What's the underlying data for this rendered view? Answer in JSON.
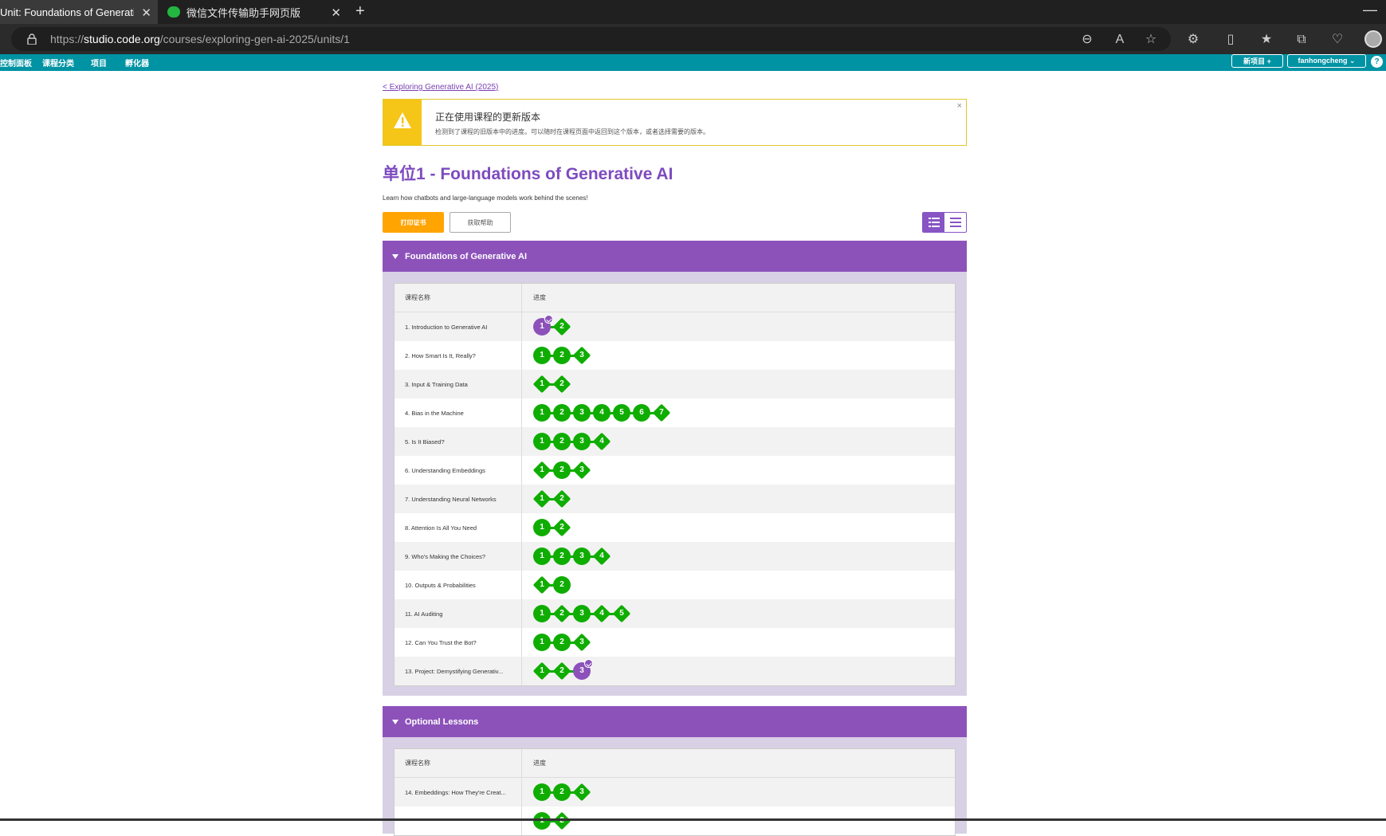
{
  "browser": {
    "tabs": [
      {
        "title": "Unit: Foundations of Generative",
        "active": true
      },
      {
        "title": "微信文件传输助手网页版",
        "active": false
      }
    ],
    "url_prefix": "https://",
    "url_domain": "studio.code.org",
    "url_path": "/courses/exploring-gen-ai-2025/units/1"
  },
  "site_nav": {
    "links": [
      "控制面板",
      "课程分类",
      "项目",
      "孵化器"
    ],
    "new_project": "新项目 +",
    "user": "fanhongcheng ⌄",
    "help": "?"
  },
  "back_link": "< Exploring Generative AI (2025)",
  "notice": {
    "title": "正在使用课程的更新版本",
    "body": "检测到了课程的旧版本中的进度。可以随时在课程页面中返回到这个版本，或者选择需要的版本。",
    "close": "×"
  },
  "unit": {
    "title": "单位1 - Foundations of Generative AI",
    "description": "Learn how chatbots and large-language models work behind the scenes!",
    "print_button": "打印证书",
    "help_button": "获取帮助"
  },
  "colors": {
    "progress_green": "#0fad00",
    "purple": "#8c52ba",
    "header_teal": "#0093a4",
    "orange": "#ffa400"
  },
  "sections": [
    {
      "title": "Foundations of Generative AI",
      "col_name": "课程名称",
      "col_progress": "进度",
      "lessons": [
        {
          "name": "1. Introduction to Generative AI",
          "levels": [
            {
              "n": "1",
              "shape": "circle",
              "color": "purple",
              "check": true
            },
            {
              "n": "2",
              "shape": "diamond"
            }
          ]
        },
        {
          "name": "2. How Smart Is It, Really?",
          "levels": [
            {
              "n": "1",
              "shape": "circle"
            },
            {
              "n": "2",
              "shape": "circle"
            },
            {
              "n": "3",
              "shape": "diamond"
            }
          ]
        },
        {
          "name": "3. Input & Training Data",
          "levels": [
            {
              "n": "1",
              "shape": "diamond"
            },
            {
              "n": "2",
              "shape": "diamond"
            }
          ]
        },
        {
          "name": "4. Bias in the Machine",
          "levels": [
            {
              "n": "1",
              "shape": "circle"
            },
            {
              "n": "2",
              "shape": "circle"
            },
            {
              "n": "3",
              "shape": "circle"
            },
            {
              "n": "4",
              "shape": "circle"
            },
            {
              "n": "5",
              "shape": "circle"
            },
            {
              "n": "6",
              "shape": "circle"
            },
            {
              "n": "7",
              "shape": "diamond"
            }
          ]
        },
        {
          "name": "5. Is It Biased?",
          "levels": [
            {
              "n": "1",
              "shape": "circle"
            },
            {
              "n": "2",
              "shape": "circle"
            },
            {
              "n": "3",
              "shape": "circle"
            },
            {
              "n": "4",
              "shape": "diamond"
            }
          ]
        },
        {
          "name": "6. Understanding Embeddings",
          "levels": [
            {
              "n": "1",
              "shape": "diamond"
            },
            {
              "n": "2",
              "shape": "circle"
            },
            {
              "n": "3",
              "shape": "diamond"
            }
          ]
        },
        {
          "name": "7. Understanding Neural Networks",
          "levels": [
            {
              "n": "1",
              "shape": "diamond"
            },
            {
              "n": "2",
              "shape": "diamond"
            }
          ]
        },
        {
          "name": "8. Attention Is All You Need",
          "levels": [
            {
              "n": "1",
              "shape": "circle"
            },
            {
              "n": "2",
              "shape": "diamond"
            }
          ]
        },
        {
          "name": "9. Who's Making the Choices?",
          "levels": [
            {
              "n": "1",
              "shape": "circle"
            },
            {
              "n": "2",
              "shape": "circle"
            },
            {
              "n": "3",
              "shape": "circle"
            },
            {
              "n": "4",
              "shape": "diamond"
            }
          ]
        },
        {
          "name": "10. Outputs & Probabilities",
          "levels": [
            {
              "n": "1",
              "shape": "diamond"
            },
            {
              "n": "2",
              "shape": "circle"
            }
          ]
        },
        {
          "name": "11. AI Auditing",
          "levels": [
            {
              "n": "1",
              "shape": "circle"
            },
            {
              "n": "2",
              "shape": "diamond"
            },
            {
              "n": "3",
              "shape": "circle"
            },
            {
              "n": "4",
              "shape": "diamond"
            },
            {
              "n": "5",
              "shape": "diamond"
            }
          ]
        },
        {
          "name": "12. Can You Trust the Bot?",
          "levels": [
            {
              "n": "1",
              "shape": "circle"
            },
            {
              "n": "2",
              "shape": "circle"
            },
            {
              "n": "3",
              "shape": "diamond"
            }
          ]
        },
        {
          "name": "13. Project: Demystifying Generativ...",
          "levels": [
            {
              "n": "1",
              "shape": "diamond"
            },
            {
              "n": "2",
              "shape": "diamond"
            },
            {
              "n": "3",
              "shape": "circle",
              "color": "purple",
              "check": true
            }
          ]
        }
      ]
    },
    {
      "title": "Optional Lessons",
      "col_name": "课程名称",
      "col_progress": "进度",
      "lessons": [
        {
          "name": "14. Embeddings: How They're Creat...",
          "levels": [
            {
              "n": "1",
              "shape": "circle"
            },
            {
              "n": "2",
              "shape": "circle"
            },
            {
              "n": "3",
              "shape": "diamond"
            }
          ]
        },
        {
          "name": "",
          "levels": [
            {
              "n": "1",
              "shape": "circle"
            },
            {
              "n": "2",
              "shape": "diamond"
            }
          ]
        }
      ]
    }
  ]
}
